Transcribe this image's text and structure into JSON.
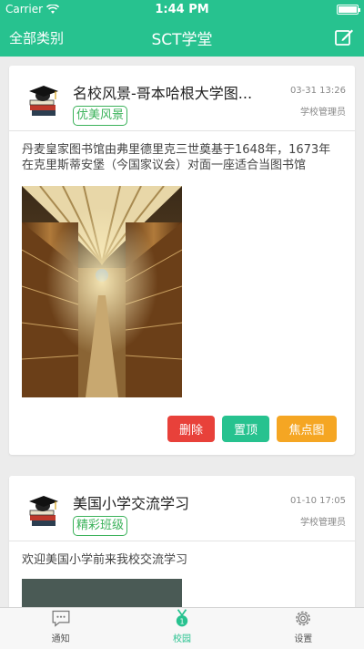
{
  "status": {
    "carrier": "Carrier",
    "time": "1:44 PM"
  },
  "nav": {
    "category_label": "全部类别",
    "title": "SCT学堂"
  },
  "posts": [
    {
      "title": "名校风景-哥本哈根大学图...",
      "tag": "优美风景",
      "date": "03-31 13:26",
      "author": "学校管理员",
      "body": "丹麦皇家图书馆由弗里德里克三世奠基于1648年，1673年在克里斯蒂安堡（今国家议会）对面一座适合当图书馆",
      "actions": {
        "delete": "删除",
        "pin": "置顶",
        "focus": "焦点图"
      }
    },
    {
      "title": "美国小学交流学习",
      "tag": "精彩班级",
      "date": "01-10 17:05",
      "author": "学校管理员",
      "body": "欢迎美国小学前来我校交流学习"
    }
  ],
  "tabs": [
    {
      "label": "通知"
    },
    {
      "label": "校园"
    },
    {
      "label": "设置"
    }
  ],
  "colors": {
    "accent": "#27c28f",
    "tag": "#3bb25a",
    "delete": "#e8413a",
    "focus": "#f5a623"
  }
}
